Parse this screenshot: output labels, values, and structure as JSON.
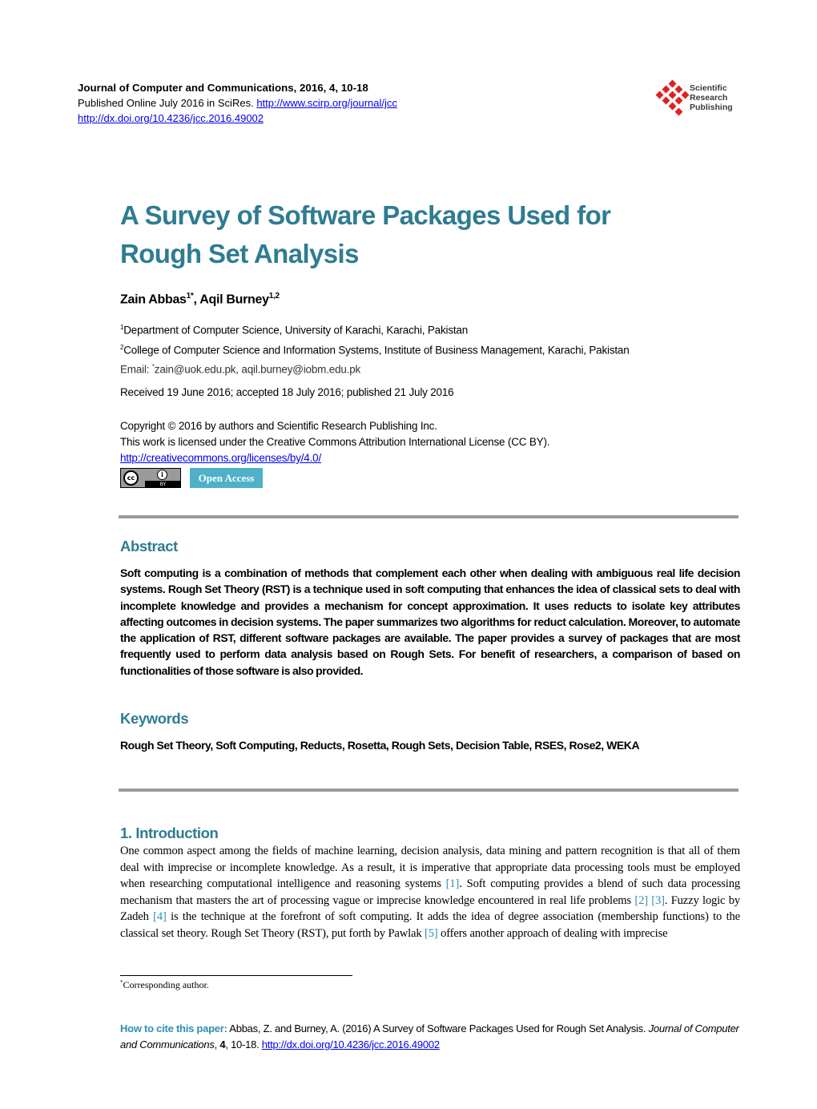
{
  "header": {
    "journal_line": "Journal of Computer and Communications, 2016, 4, 10-18",
    "published_prefix": "Published Online July 2016 in SciRes.",
    "journal_url": "http://www.scirp.org/journal/jcc",
    "doi_url": "http://dx.doi.org/10.4236/jcc.2016.49002"
  },
  "publisher_logo": {
    "line1": "Scientific",
    "line2": "Research",
    "line3": "Publishing",
    "color": "#e02020"
  },
  "title": {
    "line1": "A Survey of Software Packages Used for",
    "line2": "Rough Set Analysis",
    "color": "#2e7c92"
  },
  "authors": {
    "author1_name": "Zain Abbas",
    "author1_sup": "1*",
    "separator": ", ",
    "author2_name": "Aqil Burney",
    "author2_sup": "1,2"
  },
  "affiliations": [
    {
      "sup": "1",
      "text": "Department of Computer Science, University of Karachi, Karachi, Pakistan"
    },
    {
      "sup": "2",
      "text": "College of Computer Science and Information Systems, Institute of Business Management, Karachi, Pakistan"
    }
  ],
  "email": {
    "label": "Email: ",
    "sup": "*",
    "text": "zain@uok.edu.pk, aqil.burney@iobm.edu.pk"
  },
  "dates": "Received 19 June 2016; accepted 18 July 2016; published 21 July 2016",
  "copyright": {
    "line1": "Copyright © 2016 by authors and Scientific Research Publishing Inc.",
    "line2": "This work is licensed under the Creative Commons Attribution International License (CC BY).",
    "license_url": "http://creativecommons.org/licenses/by/4.0/"
  },
  "badges": {
    "cc_label": "cc",
    "by_icon": "i",
    "by_label": "BY",
    "open_access": "Open Access"
  },
  "abstract": {
    "heading": "Abstract",
    "text": "Soft computing is a combination of methods that complement each other when dealing with ambiguous real life decision systems. Rough Set Theory (RST) is a technique used in soft computing that enhances the idea of classical sets to deal with incomplete knowledge and provides a mechanism for concept approximation. It uses reducts to isolate key attributes affecting outcomes in decision systems. The paper summarizes two algorithms for reduct calculation. Moreover, to automate the application of RST, different software packages are available. The paper provides a survey of packages that are most frequently used to perform data analysis based on Rough Sets. For benefit of researchers, a comparison of based on functionalities of those software is also provided."
  },
  "keywords": {
    "heading": "Keywords",
    "text": "Rough Set Theory, Soft Computing, Reducts, Rosetta, Rough Sets, Decision Table, RSES, Rose2, WEKA"
  },
  "introduction": {
    "heading": "1. Introduction",
    "segments": [
      "One common aspect among the fields of machine learning, decision analysis, data mining and pattern recognition is that all of them deal with imprecise or incomplete knowledge. As a result, it is imperative that appropriate data processing tools must be employed when researching computational intelligence and reasoning systems ",
      "[1]",
      ". Soft computing provides a blend of such data processing mechanism that masters the art of processing vague or imprecise knowledge encountered in real life problems ",
      "[2]",
      " ",
      "[3]",
      ". Fuzzy logic by Zadeh ",
      "[4]",
      " is the technique at the forefront of soft computing. It adds the idea of degree association (membership functions) to the classical set theory. Rough Set Theory (RST), put forth by Pawlak ",
      "[5]",
      " offers another approach of dealing with imprecise"
    ]
  },
  "footnote": {
    "sup": "*",
    "text": "Corresponding author."
  },
  "citation": {
    "lead": "How to cite this paper:",
    "text1": " Abbas, Z. and Burney, A. (2016) A Survey of Software Packages Used for Rough Set Analysis. ",
    "journal": "Journal of Computer and Communications",
    "text2": ", ",
    "volume": "4",
    "text3": ", 10-18. ",
    "doi_url": "http://dx.doi.org/10.4236/jcc.2016.49002"
  },
  "colors": {
    "heading_teal": "#2e7c92",
    "reference_blue": "#2e8fb0",
    "rule_gray": "#9b9b9b",
    "open_access_bg": "#4eb1c7"
  }
}
